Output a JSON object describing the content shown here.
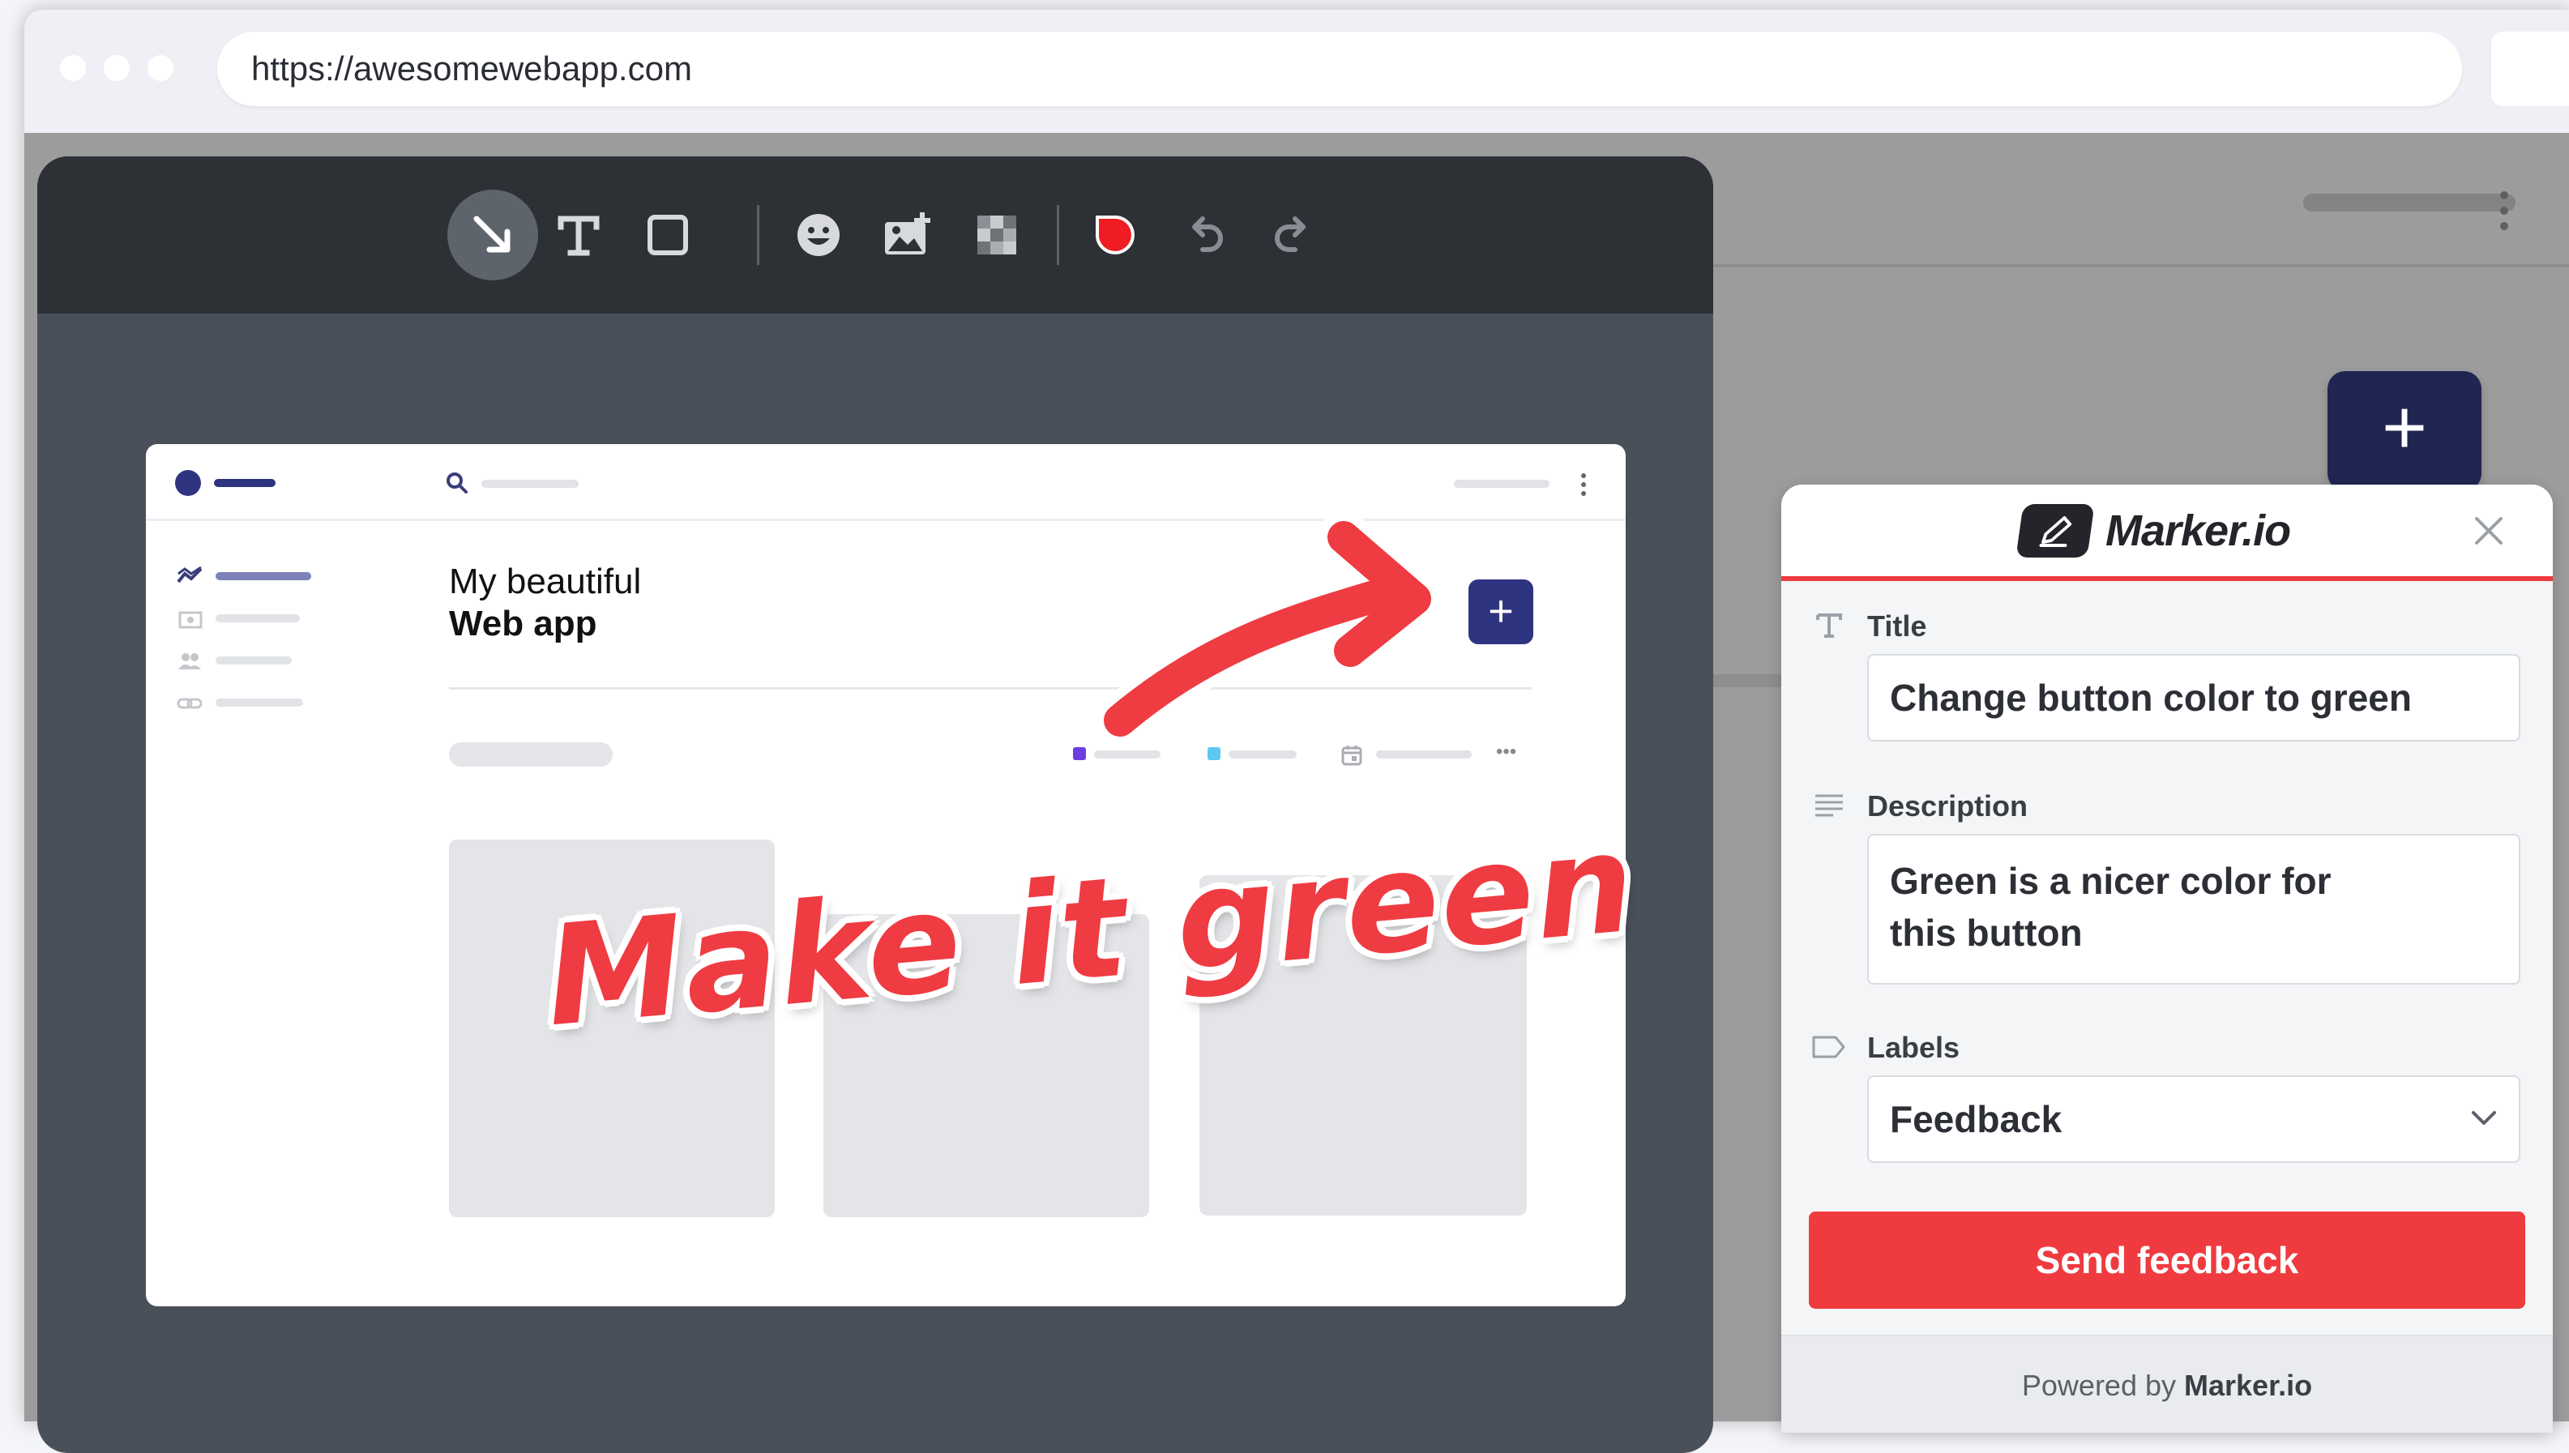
{
  "browser": {
    "url": "https://awesomewebapp.com"
  },
  "toolbar": {
    "tools": [
      {
        "name": "arrow-tool",
        "active": true
      },
      {
        "name": "text-tool"
      },
      {
        "name": "rectangle-tool"
      },
      {
        "name": "emoji-tool"
      },
      {
        "name": "image-tool"
      },
      {
        "name": "blur-tool"
      },
      {
        "name": "color-picker"
      },
      {
        "name": "undo"
      },
      {
        "name": "redo"
      }
    ],
    "active_color": "#ef1c24"
  },
  "screenshot": {
    "title_line1": "My beautiful",
    "title_line2": "Web app",
    "fab_label": "+"
  },
  "annotation": {
    "text": "Make it green",
    "color": "#ef3b42"
  },
  "background": {
    "fab_label": "+"
  },
  "panel": {
    "brand": "Marker.io",
    "title_label": "Title",
    "title_value": "Change button color to green",
    "description_label": "Description",
    "description_line1": "Green is a nicer color for",
    "description_line2": "this button",
    "labels_label": "Labels",
    "labels_value": "Feedback",
    "send_button": "Send feedback",
    "footer_prefix": "Powered by",
    "footer_brand": "Marker.io",
    "accent_color": "#ef3b3f"
  }
}
